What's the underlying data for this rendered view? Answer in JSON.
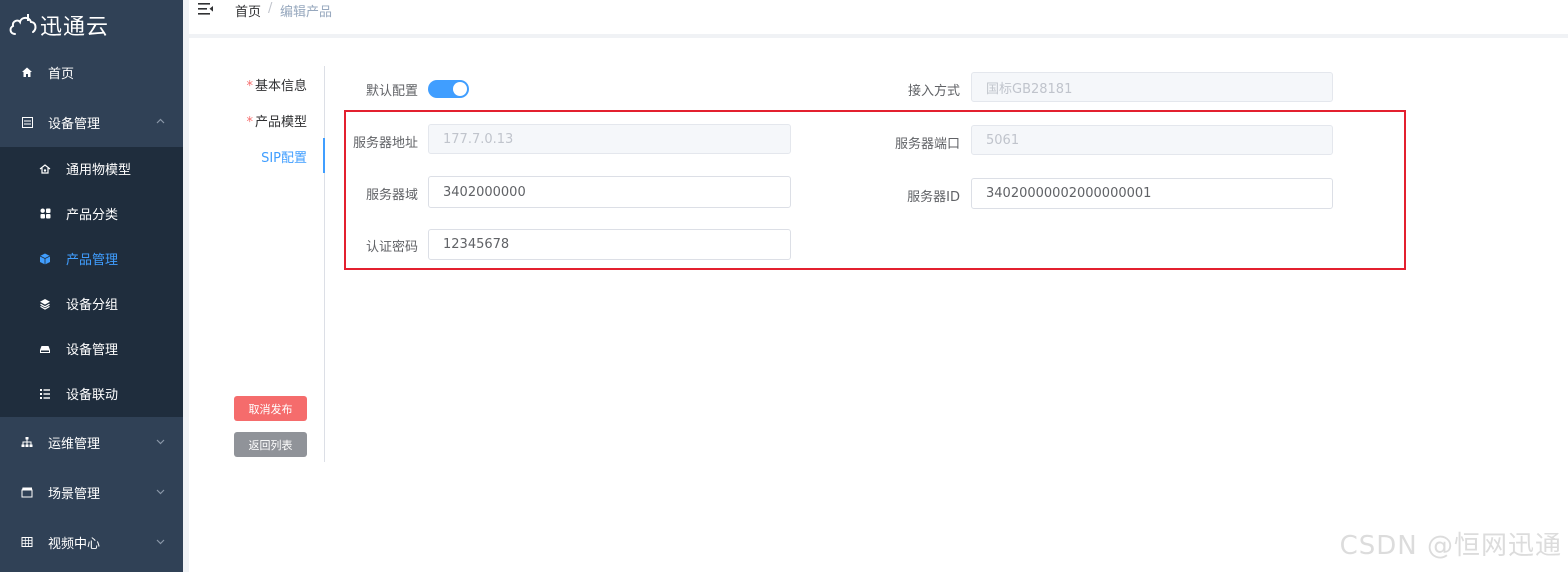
{
  "app": {
    "brand": "迅通云"
  },
  "sidebar": {
    "items": [
      {
        "label": "首页",
        "icon": "home-icon"
      },
      {
        "label": "设备管理",
        "icon": "device-icon",
        "expanded": true,
        "children": [
          {
            "label": "通用物模型",
            "icon": "model-icon"
          },
          {
            "label": "产品分类",
            "icon": "category-icon"
          },
          {
            "label": "产品管理",
            "icon": "cube-icon",
            "active": true
          },
          {
            "label": "设备分组",
            "icon": "layers-icon"
          },
          {
            "label": "设备管理",
            "icon": "drive-icon"
          },
          {
            "label": "设备联动",
            "icon": "list-icon"
          }
        ]
      },
      {
        "label": "运维管理",
        "icon": "sitemap-icon"
      },
      {
        "label": "场景管理",
        "icon": "clapper-icon"
      },
      {
        "label": "视频中心",
        "icon": "grid-icon"
      }
    ]
  },
  "breadcrumb": {
    "home": "首页",
    "separator": "/",
    "current": "编辑产品"
  },
  "steps": [
    {
      "label": "基本信息",
      "required": "*"
    },
    {
      "label": "产品模型",
      "required": "*"
    },
    {
      "label": "SIP配置",
      "active": true
    }
  ],
  "actions": {
    "cancel_publish": "取消发布",
    "back_to_list": "返回列表"
  },
  "form": {
    "default_config": {
      "label": "默认配置",
      "enabled": true
    },
    "access_method": {
      "label": "接入方式",
      "value": "国标GB28181"
    },
    "server_address": {
      "label": "服务器地址",
      "value": "177.7.0.13"
    },
    "server_port": {
      "label": "服务器端口",
      "value": "5061"
    },
    "server_domain": {
      "label": "服务器域",
      "value": "3402000000"
    },
    "server_id": {
      "label": "服务器ID",
      "value": "34020000002000000001"
    },
    "auth_password": {
      "label": "认证密码",
      "value": "12345678"
    }
  },
  "watermark": "CSDN @恒网迅通",
  "colors": {
    "sidebar": "#304156",
    "submenu": "#1f2d3d",
    "primary": "#409eff",
    "danger": "#f56c6c",
    "info": "#909399",
    "highlight_box": "#e3202f"
  }
}
